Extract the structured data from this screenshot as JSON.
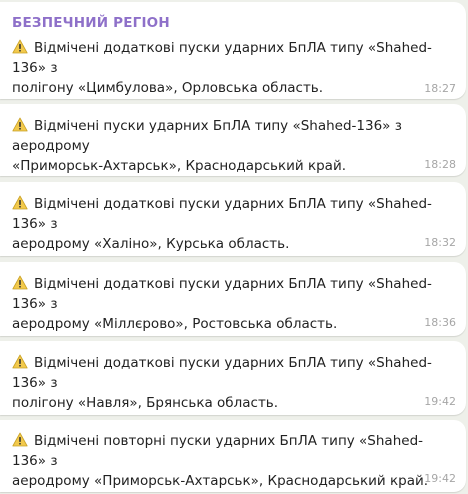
{
  "channel": {
    "name": "БЕЗПЕЧНИЙ РЕГІОН"
  },
  "icons": {
    "warning": "warning-icon",
    "warning_color": "#f2c94c"
  },
  "colors": {
    "channel_name": "#8e70c9",
    "background": "#eef0ea",
    "bubble": "#ffffff",
    "timestamp": "#a6a6a6"
  },
  "messages": [
    {
      "line1": "Відмічені додаткові пуски ударних БпЛА типу «Shahed-136» з",
      "line2": "полігону «Цимбулова», Орловська область.",
      "time": "18:27"
    },
    {
      "line1": "Відмічені пуски ударних БпЛА типу «Shahed-136» з аеродрому",
      "line2": "«Приморськ-Ахтарськ», Краснодарський край.",
      "time": "18:28"
    },
    {
      "line1": "Відмічені додаткові пуски ударних БпЛА типу «Shahed-136» з",
      "line2": "аеродрому «Халіно», Курська область.",
      "time": "18:32"
    },
    {
      "line1": "Відмічені додаткові пуски ударних БпЛА типу «Shahed-136» з",
      "line2": "аеродрому «Міллєрово», Ростовська область.",
      "time": "18:36"
    },
    {
      "line1": "Відмічені додаткові пуски ударних БпЛА типу «Shahed-136» з",
      "line2": "полігону «Навля», Брянська область.",
      "time": "19:42"
    },
    {
      "line1": "Відмічені повторні пуски ударних БпЛА типу «Shahed-136» з",
      "line2": "аеродрому «Приморськ-Ахтарськ», Краснодарський край.",
      "time": "19:42"
    }
  ]
}
